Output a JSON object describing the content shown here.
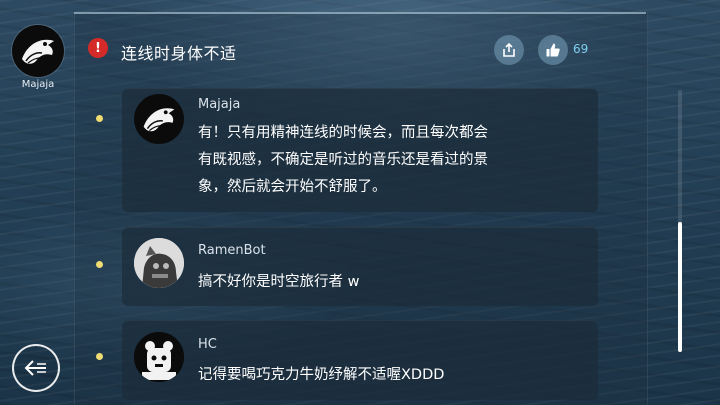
{
  "user": {
    "name": "Majaja",
    "avatar_icon": "bird-avatar-icon"
  },
  "topic": {
    "title": "连线时身体不适",
    "alert_icon": "exclamation-icon",
    "alert_symbol": "!",
    "like_count": "69"
  },
  "comments": [
    {
      "author": "Majaja",
      "lines": [
        "有！只有用精神连线的时候会，而且每次都会",
        "有既视感，不确定是听过的音乐还是看过的景",
        "象，然后就会开始不舒服了。"
      ],
      "avatar_icon": "bird-avatar-icon"
    },
    {
      "author": "RamenBot",
      "lines": [
        "搞不好你是时空旅行者 w"
      ],
      "avatar_icon": "robot-avatar-icon"
    },
    {
      "author": "HC",
      "lines": [
        "记得要喝巧克力牛奶纾解不适喔XDDD"
      ],
      "avatar_icon": "bear-avatar-icon"
    }
  ],
  "colors": {
    "alert": "#d42a2a",
    "like_count": "#7fd0f0",
    "bullet": "#f0dc72"
  },
  "scroll": {
    "position_fraction": 0.5
  }
}
